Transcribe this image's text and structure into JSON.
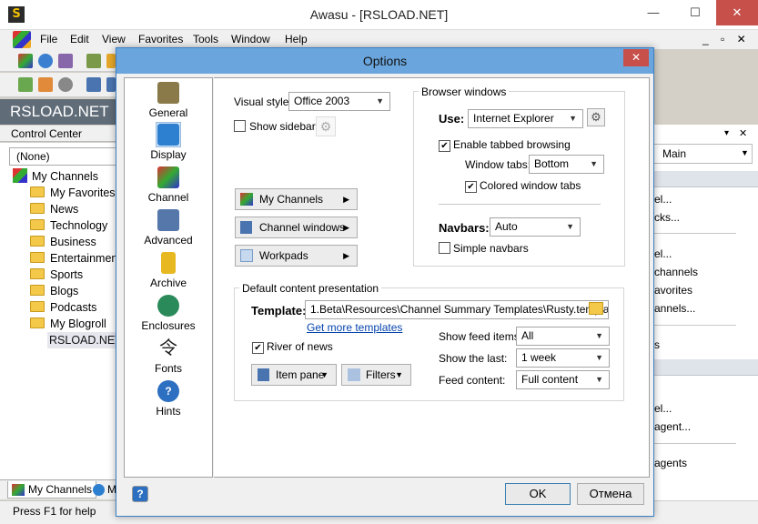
{
  "window": {
    "title": "Awasu - [RSLOAD.NET]",
    "minimize": "—",
    "maximize": "☐",
    "close": "✕"
  },
  "menubar": {
    "items": [
      "File",
      "Edit",
      "View",
      "Favorites",
      "Tools",
      "Window",
      "Help"
    ],
    "mdi_controls": "_ ▫ ✕"
  },
  "banner": {
    "title": "RSLOAD.NET"
  },
  "control_center": {
    "title": "Control Center",
    "close": "✕",
    "selector": "(None)",
    "tree": {
      "root": "My Channels",
      "folders": [
        "My Favorites",
        "News",
        "Technology",
        "Business",
        "Entertainment",
        "Sports",
        "Blogs",
        "Podcasts",
        "My Blogroll"
      ],
      "selected_child": "RSLOAD.NET"
    },
    "tabs": [
      "My Channels",
      "M"
    ]
  },
  "status": {
    "text": "Press F1 for help"
  },
  "right_panel": {
    "pin": "▾",
    "close": "✕",
    "dropdown": "Main",
    "items": [
      "el...",
      "cks...",
      "el...",
      "channels",
      "avorites",
      "annels...",
      "s",
      "el...",
      "agent...",
      "agents"
    ]
  },
  "dialog": {
    "title": "Options",
    "close": "✕",
    "nav": [
      {
        "label": "General",
        "icon": "general-icon",
        "color": "#8a7a4a"
      },
      {
        "label": "Display",
        "icon": "display-icon",
        "color": "#2d7fd0"
      },
      {
        "label": "Channel",
        "icon": "channel-icon",
        "color": "#3a8a3a"
      },
      {
        "label": "Advanced",
        "icon": "tools-icon",
        "color": "#5577aa"
      },
      {
        "label": "Archive",
        "icon": "archive-icon",
        "color": "#e8b820"
      },
      {
        "label": "Enclosures",
        "icon": "globe-icon",
        "color": "#2a8a5a"
      },
      {
        "label": "Fonts",
        "icon": "fonts-icon",
        "color": "#222222"
      },
      {
        "label": "Hints",
        "icon": "help-icon",
        "color": "#2d6fc0"
      }
    ],
    "selected_nav": "Display",
    "visual_style": {
      "label": "Visual style:",
      "value": "Office 2003"
    },
    "show_sidebar": {
      "label": "Show sidebar",
      "checked": false
    },
    "menu_buttons": [
      "My Channels",
      "Channel windows",
      "Workpads"
    ],
    "browser_windows": {
      "title": "Browser windows",
      "use_label": "Use:",
      "use_value": "Internet Explorer",
      "tabbed_browsing": {
        "label": "Enable tabbed browsing",
        "checked": true
      },
      "window_tabs_label": "Window tabs:",
      "window_tabs_value": "Bottom",
      "colored_tabs": {
        "label": "Colored window tabs",
        "checked": true
      },
      "navbars_label": "Navbars:",
      "navbars_value": "Auto",
      "simple_navbars": {
        "label": "Simple navbars",
        "checked": false
      }
    },
    "content_presentation": {
      "title": "Default content presentation",
      "template_label": "Template:",
      "template_value": "1.Beta\\Resources\\Channel Summary Templates\\Rusty.template",
      "get_more": "Get more templates",
      "river_of_news": {
        "label": "River of news",
        "checked": true
      },
      "item_pane": "Item pane",
      "filters": "Filters",
      "show_feed_items_label": "Show feed items:",
      "show_feed_items_value": "All",
      "show_last_label": "Show the last:",
      "show_last_value": "1 week",
      "feed_content_label": "Feed content:",
      "feed_content_value": "Full content"
    },
    "help": "?",
    "ok": "OK",
    "cancel": "Отмена"
  },
  "colors": {
    "accent": "#6aa6dd",
    "close": "#c7504b",
    "banner": "#606c78",
    "link": "#0645ad"
  }
}
